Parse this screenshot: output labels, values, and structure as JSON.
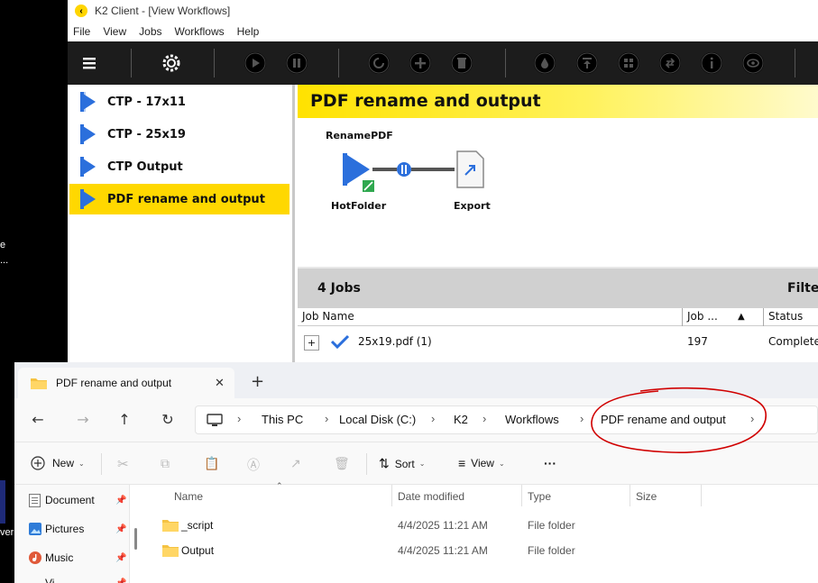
{
  "desktop": {
    "frag1": "e",
    "frag2": "...",
    "frag3": "ver"
  },
  "k2": {
    "title": "K2 Client - [View Workflows]",
    "menu": [
      "File",
      "View",
      "Jobs",
      "Workflows",
      "Help"
    ],
    "toolbar_icons": [
      "menu-icon",
      "settings-icon",
      "play-icon",
      "pause-icon",
      "refresh-icon",
      "add-icon",
      "delete-icon",
      "drop-icon",
      "upload-icon",
      "grid-icon",
      "swap-icon",
      "info-icon",
      "view-icon"
    ],
    "workflows": [
      {
        "label": "CTP - 17x11",
        "selected": false
      },
      {
        "label": "CTP - 25x19",
        "selected": false
      },
      {
        "label": "CTP Output",
        "selected": false
      },
      {
        "label": "PDF rename and output",
        "selected": true
      }
    ],
    "main_title": "PDF rename and output",
    "flow": {
      "step_top": "RenamePDF",
      "node1": "HotFolder",
      "node2": "Export"
    },
    "jobs": {
      "count_label": "4 Jobs",
      "filter_label": "Filter",
      "columns": [
        "Job Name",
        "Job ...",
        "Status"
      ],
      "rows": [
        {
          "expand": "+",
          "name": "25x19.pdf (1)",
          "job": "197",
          "status": "Complete"
        }
      ]
    },
    "accent": "#ffd800"
  },
  "explorer": {
    "tab_title": "PDF rename and output",
    "tab_close": "✕",
    "new_tab": "+",
    "breadcrumbs": [
      "This PC",
      "Local Disk (C:)",
      "K2",
      "Workflows",
      "PDF rename and output"
    ],
    "commands": {
      "new": "New",
      "sort": "Sort",
      "view": "View",
      "more": "···"
    },
    "nav_pane": [
      {
        "label": "Document",
        "pin": "📌"
      },
      {
        "label": "Pictures",
        "pin": "📌"
      },
      {
        "label": "Music",
        "pin": "📌"
      },
      {
        "label": "Vi",
        "pin": "📌"
      }
    ],
    "columns": [
      "Name",
      "Date modified",
      "Type",
      "Size"
    ],
    "files": [
      {
        "name": "_script",
        "modified": "4/4/2025 11:21 AM",
        "type": "File folder",
        "size": ""
      },
      {
        "name": "Output",
        "modified": "4/4/2025 11:21 AM",
        "type": "File folder",
        "size": ""
      }
    ],
    "annotation_color": "#d00000"
  }
}
